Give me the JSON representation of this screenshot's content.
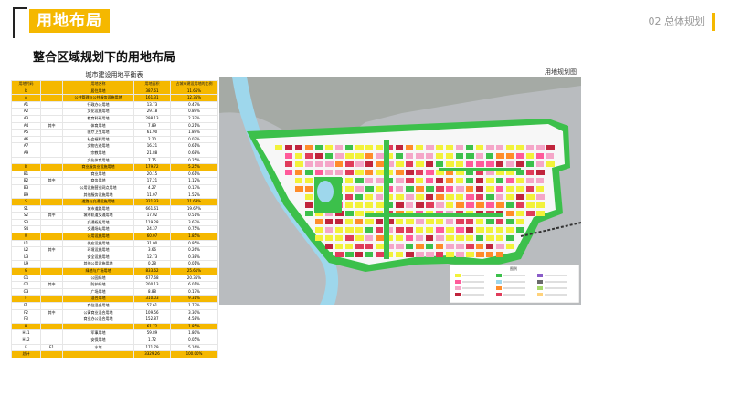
{
  "header": {
    "title": "用地布局",
    "section": "02 总体规划"
  },
  "subtitle": "整合区域规划下的用地布局",
  "table": {
    "caption": "城市建设用地平衡表",
    "headers": [
      "用地代码",
      "",
      "用地名称",
      "用地面积",
      "占城市建设用地的比例"
    ],
    "rows": [
      {
        "type": "cat",
        "code": "R",
        "mid": "",
        "name": "居住用地",
        "area": "387.61",
        "pct": "11.65%"
      },
      {
        "type": "cat",
        "code": "A",
        "mid": "",
        "name": "公共管理与公共服务设施用地",
        "area": "161.31",
        "pct": "12.35%"
      },
      {
        "type": "sub",
        "code": "A1",
        "mid": "",
        "name": "行政办公用地",
        "area": "13.73",
        "pct": "0.47%"
      },
      {
        "type": "sub",
        "code": "A2",
        "mid": "",
        "name": "文化设施用地",
        "area": "29.18",
        "pct": "0.89%"
      },
      {
        "type": "sub",
        "code": "A3",
        "mid": "",
        "name": "教育科研用地",
        "area": "298.13",
        "pct": "2.37%"
      },
      {
        "type": "sub",
        "code": "A4",
        "mid": "其中",
        "name": "体育用地",
        "area": "7.89",
        "pct": "0.21%"
      },
      {
        "type": "sub",
        "code": "A5",
        "mid": "",
        "name": "医疗卫生用地",
        "area": "61.90",
        "pct": "1.89%"
      },
      {
        "type": "sub",
        "code": "A6",
        "mid": "",
        "name": "社会福利用地",
        "area": "2.20",
        "pct": "0.07%"
      },
      {
        "type": "sub",
        "code": "A7",
        "mid": "",
        "name": "文物古迹用地",
        "area": "16.21",
        "pct": "0.61%"
      },
      {
        "type": "sub",
        "code": "A9",
        "mid": "",
        "name": "宗教用地",
        "area": "21.88",
        "pct": "0.68%"
      },
      {
        "type": "sub",
        "code": "",
        "mid": "",
        "name": "文化体育用地",
        "area": "7.75",
        "pct": "0.25%"
      },
      {
        "type": "cat",
        "code": "B",
        "mid": "",
        "name": "商业服务业设施用地",
        "area": "179.72",
        "pct": "5.25%"
      },
      {
        "type": "sub",
        "code": "B1",
        "mid": "",
        "name": "商业用地",
        "area": "20.15",
        "pct": "0.61%"
      },
      {
        "type": "sub",
        "code": "B2",
        "mid": "其中",
        "name": "商务用地",
        "area": "17.21",
        "pct": "1.12%"
      },
      {
        "type": "sub",
        "code": "B3",
        "mid": "",
        "name": "公用设施营业网点用地",
        "area": "4.27",
        "pct": "0.13%"
      },
      {
        "type": "sub",
        "code": "B9",
        "mid": "",
        "name": "其他服务设施用地",
        "area": "11.07",
        "pct": "1.52%"
      },
      {
        "type": "cat",
        "code": "S",
        "mid": "",
        "name": "道路与交通设施用地",
        "area": "321.33",
        "pct": "21.68%"
      },
      {
        "type": "sub",
        "code": "S1",
        "mid": "",
        "name": "城市道路用地",
        "area": "661.61",
        "pct": "19.67%"
      },
      {
        "type": "sub",
        "code": "S2",
        "mid": "其中",
        "name": "城市轨道交通用地",
        "area": "17.02",
        "pct": "0.51%"
      },
      {
        "type": "sub",
        "code": "S3",
        "mid": "",
        "name": "交通枢纽用地",
        "area": "119.28",
        "pct": "3.63%"
      },
      {
        "type": "sub",
        "code": "S4",
        "mid": "",
        "name": "交通场站用地",
        "area": "24.37",
        "pct": "0.75%"
      },
      {
        "type": "cat",
        "code": "U",
        "mid": "",
        "name": "公用设施用地",
        "area": "60.07",
        "pct": "1.85%"
      },
      {
        "type": "sub",
        "code": "U1",
        "mid": "",
        "name": "供应设施用地",
        "area": "31.00",
        "pct": "0.95%"
      },
      {
        "type": "sub",
        "code": "U2",
        "mid": "其中",
        "name": "环境设施用地",
        "area": "3.66",
        "pct": "0.26%"
      },
      {
        "type": "sub",
        "code": "U3",
        "mid": "",
        "name": "安全设施用地",
        "area": "12.73",
        "pct": "0.38%"
      },
      {
        "type": "sub",
        "code": "U9",
        "mid": "",
        "name": "其他公用设施用地",
        "area": "0.28",
        "pct": "0.01%"
      },
      {
        "type": "cat",
        "code": "G",
        "mid": "",
        "name": "绿地与广场用地",
        "area": "833.62",
        "pct": "25.61%"
      },
      {
        "type": "sub",
        "code": "G1",
        "mid": "",
        "name": "公园绿地",
        "area": "677.68",
        "pct": "20.35%"
      },
      {
        "type": "sub",
        "code": "G2",
        "mid": "其中",
        "name": "防护绿地",
        "area": "200.13",
        "pct": "6.01%"
      },
      {
        "type": "sub",
        "code": "G3",
        "mid": "",
        "name": "广场用地",
        "area": "8.88",
        "pct": "0.17%"
      },
      {
        "type": "cat",
        "code": "F",
        "mid": "",
        "name": "混合用地",
        "area": "310.03",
        "pct": "9.31%"
      },
      {
        "type": "sub",
        "code": "F1",
        "mid": "",
        "name": "商住混合用地",
        "area": "57.61",
        "pct": "1.73%"
      },
      {
        "type": "sub",
        "code": "F2",
        "mid": "其中",
        "name": "公寓商业混合用地",
        "area": "109.56",
        "pct": "3.30%"
      },
      {
        "type": "sub",
        "code": "F3",
        "mid": "",
        "name": "商业办公混合用地",
        "area": "152.87",
        "pct": "4.58%"
      },
      {
        "type": "cat",
        "code": "H",
        "mid": "",
        "name": "",
        "area": "61.72",
        "pct": "1.85%"
      },
      {
        "type": "sub",
        "code": "H11",
        "mid": "",
        "name": "军事用地",
        "area": "59.89",
        "pct": "1.80%"
      },
      {
        "type": "sub",
        "code": "H12",
        "mid": "",
        "name": "安保用地",
        "area": "1.72",
        "pct": "0.05%"
      },
      {
        "type": "sub",
        "code": "E",
        "mid": "E1",
        "name": "水域",
        "area": "171.79",
        "pct": "5.16%"
      },
      {
        "type": "total",
        "code": "总计",
        "mid": "",
        "name": "",
        "area": "3329.26",
        "pct": "100.00%"
      }
    ]
  },
  "map": {
    "label": "用地规划图",
    "legend_title": "图例"
  },
  "colors": {
    "accent": "#f5b800",
    "residential": "#f2f23a",
    "commercial": "#ff5a9a",
    "public": "#f5a6c8",
    "green": "#3cc04b",
    "water": "#9ed7ec",
    "road": "#ffffff",
    "industrial": "#c0243c"
  }
}
